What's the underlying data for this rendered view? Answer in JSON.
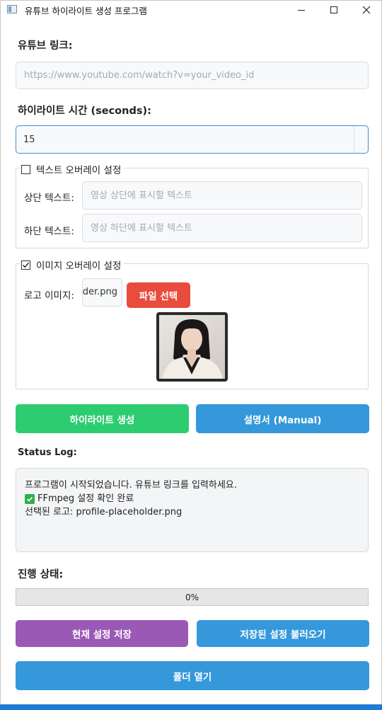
{
  "window": {
    "title": "유튜브 하이라이트 생성 프로그램"
  },
  "youtube": {
    "label": "유튜브 링크:",
    "placeholder": "https://www.youtube.com/watch?v=your_video_id"
  },
  "duration": {
    "label": "하이라이트 시간 (seconds):",
    "value": "15"
  },
  "text_overlay": {
    "title": "텍스트 오버레이 설정",
    "checked": false,
    "top_label": "상단 텍스트:",
    "top_placeholder": "영상 상단에 표시할 텍스트",
    "bottom_label": "하단 텍스트:",
    "bottom_placeholder": "영상 하단에 표시할 텍스트"
  },
  "image_overlay": {
    "title": "이미지 오버레이 설정",
    "checked": true,
    "logo_label": "로고 이미지:",
    "logo_value": "profile-placeholder.png",
    "select_button": "파일 선택"
  },
  "actions": {
    "generate": "하이라이트 생성",
    "manual": "설명서 (Manual)"
  },
  "status": {
    "label": "Status Log:",
    "lines": [
      "프로그램이 시작되었습니다. 유튜브 링크를 입력하세요.",
      "FFmpeg 설정 확인 완료",
      "선택된 로고: profile-placeholder.png"
    ]
  },
  "progress": {
    "label": "진행 상태:",
    "value": 0,
    "text": "0%"
  },
  "settings": {
    "save": "현재 설정 저장",
    "load": "저장된 설정 불러오기",
    "open_folder": "폴더 열기"
  },
  "colors": {
    "green": "#2ecc71",
    "blue": "#3498db",
    "red": "#e74c3c",
    "purple": "#9b59b6"
  },
  "icons": {
    "app": "window-icon",
    "check_emoji": "green-check-icon"
  }
}
